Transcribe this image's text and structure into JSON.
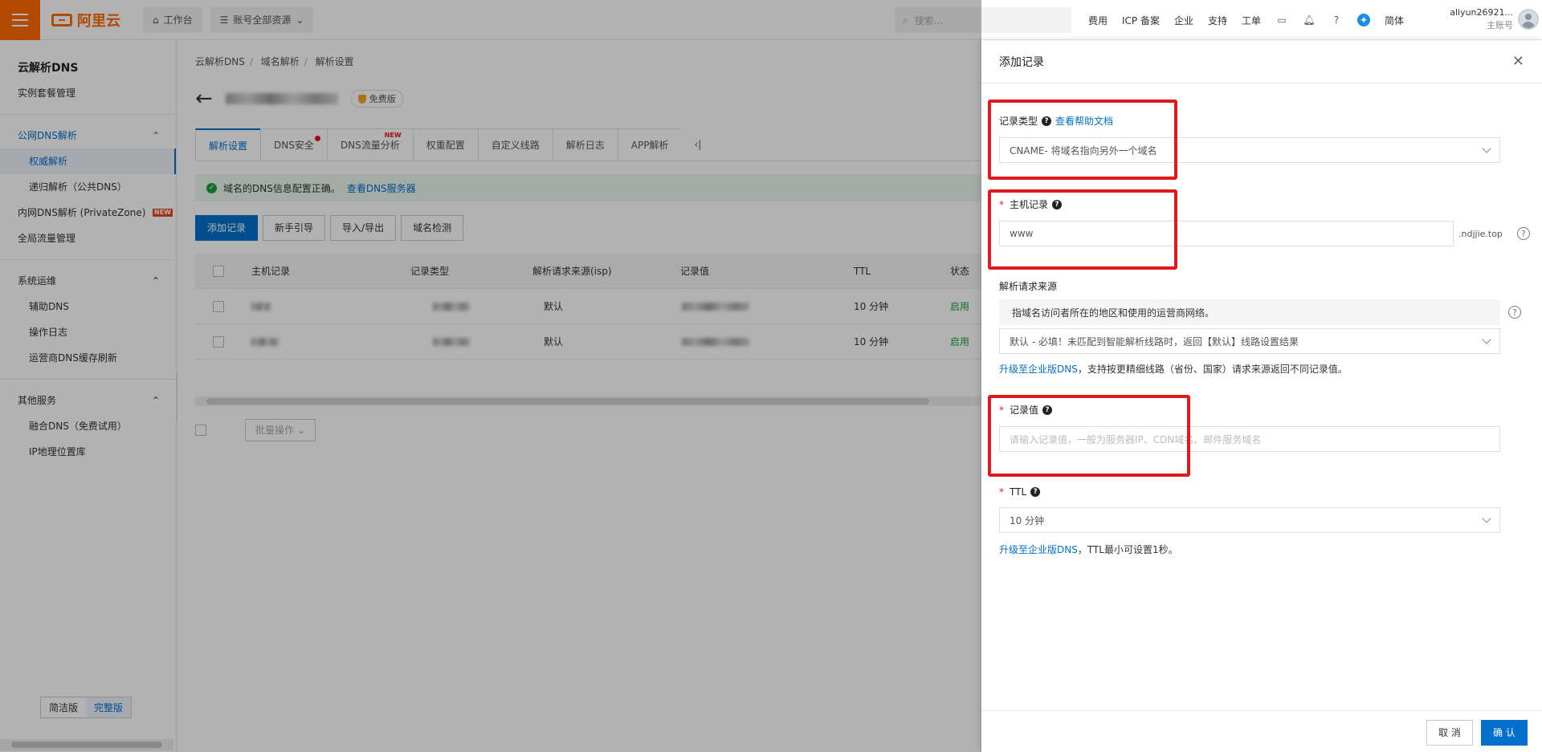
{
  "topbar": {
    "logo_text": "阿里云",
    "workbench": "工作台",
    "resources": "账号全部资源",
    "search_placeholder": "搜索...",
    "nav": [
      "费用",
      "ICP 备案",
      "企业",
      "支持",
      "工单"
    ],
    "lang": "简体",
    "user_name": "aliyun26921...",
    "user_role": "主账号"
  },
  "sidebar": {
    "title": "云解析DNS",
    "instance": "实例套餐管理",
    "group_public": "公网DNS解析",
    "auth_resolve": "权威解析",
    "recursive": "递归解析（公共DNS）",
    "private_zone": "内网DNS解析 (PrivateZone)",
    "new_tag": "NEW",
    "gtm": "全局流量管理",
    "group_ops": "系统运维",
    "aux_dns": "辅助DNS",
    "op_log": "操作日志",
    "isp_refresh": "运营商DNS缓存刷新",
    "group_other": "其他服务",
    "fusion_dns": "融合DNS（免费试用）",
    "ip_geo": "IP地理位置库",
    "version_simple": "简洁版",
    "version_full": "完整版"
  },
  "main": {
    "breadcrumb": [
      "云解析DNS",
      "域名解析",
      "解析设置"
    ],
    "free_badge": "免费版",
    "tabs": [
      "解析设置",
      "DNS安全",
      "DNS流量分析",
      "权重配置",
      "自定义线路",
      "解析日志",
      "APP解析"
    ],
    "tab_new": "NEW",
    "alert_text": "域名的DNS信息配置正确。",
    "alert_link": "查看DNS服务器",
    "buttons": [
      "添加记录",
      "新手引导",
      "导入/导出",
      "域名检测"
    ],
    "columns": [
      "主机记录",
      "记录类型",
      "解析请求来源(isp)",
      "记录值",
      "TTL",
      "状态"
    ],
    "rows": [
      {
        "line": "默认",
        "ttl": "10 分钟",
        "status": "启用"
      },
      {
        "line": "默认",
        "ttl": "10 分钟",
        "status": "启用"
      }
    ],
    "batch": "批量操作"
  },
  "drawer": {
    "title": "添加记录",
    "type_label": "记录类型",
    "help_link": "查看帮助文档",
    "type_value": "CNAME- 将域名指向另外一个域名",
    "host_label": "主机记录",
    "host_value": "www",
    "host_suffix": ".ndjjie.top",
    "source_label": "解析请求来源",
    "source_hint": "指域名访问者所在的地区和使用的运营商网络。",
    "source_value": "默认 - 必填！未匹配到智能解析线路时，返回【默认】线路设置结果",
    "upgrade_link": "升级至企业版DNS",
    "source_note": "，支持按更精细线路（省份、国家）请求来源返回不同记录值。",
    "value_label": "记录值",
    "value_placeholder": "请输入记录值，一般为服务器IP、CDN域名、邮件服务域名",
    "ttl_label": "TTL",
    "ttl_value": "10 分钟",
    "ttl_note": "，TTL最小可设置1秒。",
    "cancel": "取 消",
    "confirm": "确 认"
  }
}
